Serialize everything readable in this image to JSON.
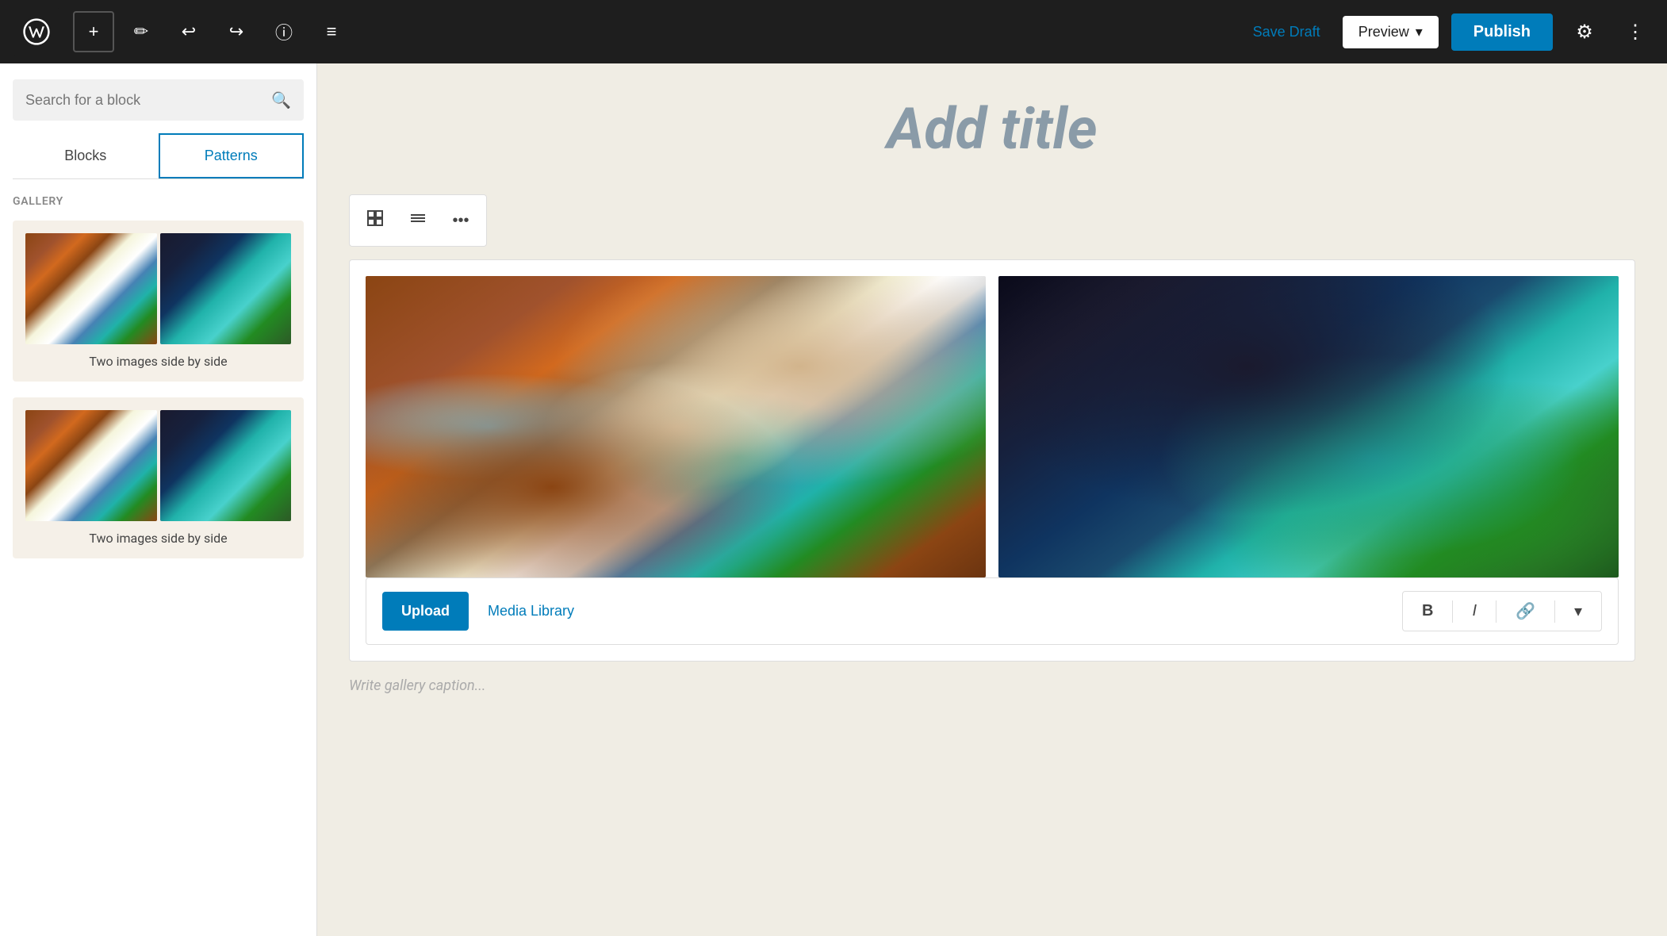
{
  "toolbar": {
    "add_label": "+",
    "save_draft_label": "Save Draft",
    "preview_label": "Preview",
    "publish_label": "Publish"
  },
  "sidebar": {
    "search_placeholder": "Search for a block",
    "tabs": [
      {
        "id": "blocks",
        "label": "Blocks",
        "active": false
      },
      {
        "id": "patterns",
        "label": "Patterns",
        "active": true
      }
    ],
    "gallery_label": "GALLERY",
    "patterns": [
      {
        "id": 1,
        "label": "Two images side by side"
      },
      {
        "id": 2,
        "label": "Two images side by side"
      }
    ]
  },
  "editor": {
    "title_placeholder": "Add title",
    "caption_placeholder": "Write gallery caption...",
    "upload_label": "Upload",
    "media_library_label": "Media Library"
  },
  "block_toolbar": {
    "gallery_icon": "🖼",
    "layout_icon": "☰",
    "more_icon": "•••"
  }
}
